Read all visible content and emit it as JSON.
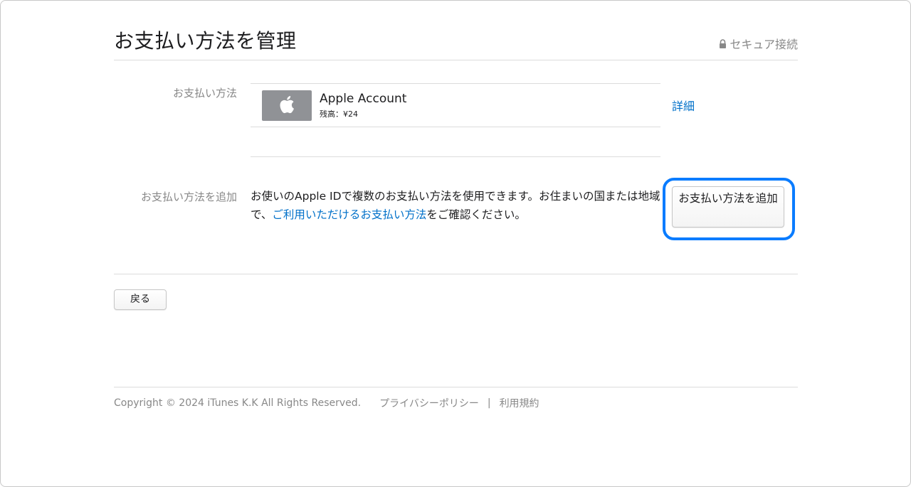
{
  "header": {
    "title": "お支払い方法を管理",
    "secure_label": "セキュア接続"
  },
  "payment_method": {
    "row_label": "お支払い方法",
    "name": "Apple Account",
    "balance": "残高：¥24",
    "details_link": "詳細"
  },
  "add_payment": {
    "row_label": "お支払い方法を追加",
    "description_before_link": "お使いのApple IDで複数のお支払い方法を使用できます。お住まいの国または地域で、",
    "description_link": "ご利用いただけるお支払い方法",
    "description_after_link": "をご確認ください。",
    "button_label": "お支払い方法を追加"
  },
  "back_button": "戻る",
  "footer": {
    "copyright": "Copyright © 2024 iTunes K.K All Rights Reserved.",
    "privacy_link": "プライバシーポリシー",
    "separator": "|",
    "terms_link": "利用規約"
  },
  "colors": {
    "link": "#0070c9",
    "highlight": "#0a7cff",
    "card_thumb": "#909296"
  },
  "icons": {
    "secure": "lock-icon",
    "card": "apple-logo-icon"
  }
}
